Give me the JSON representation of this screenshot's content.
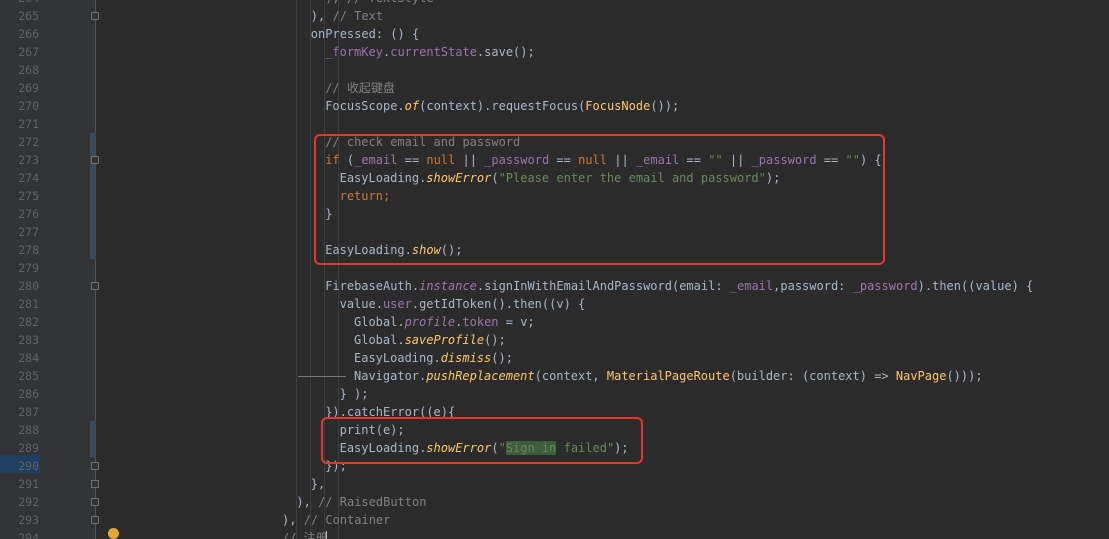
{
  "editor": {
    "language": "dart",
    "colors": {
      "background": "#2b2b2b",
      "gutter": "#313335",
      "keyword": "#cc7832",
      "property": "#9876aa",
      "string": "#6a8759",
      "comment": "#808080",
      "function": "#ffc66d",
      "highlight_box": "#e4372e"
    },
    "lines": [
      {
        "num": "264",
        "indent": 26,
        "tokens": [
          {
            "t": "), // TextStyle",
            "c": "c"
          }
        ]
      },
      {
        "num": "265",
        "indent": 24,
        "tokens": [
          {
            "t": "), ",
            "c": "n"
          },
          {
            "t": "// Text",
            "c": "c"
          }
        ]
      },
      {
        "num": "266",
        "indent": 24,
        "tokens": [
          {
            "t": "onPressed",
            "c": "n"
          },
          {
            "t": ": () {",
            "c": "n"
          }
        ]
      },
      {
        "num": "267",
        "indent": 26,
        "tokens": [
          {
            "t": "_formKey",
            "c": "p"
          },
          {
            "t": ".",
            "c": "n"
          },
          {
            "t": "currentState",
            "c": "p"
          },
          {
            "t": ".save();",
            "c": "n"
          }
        ]
      },
      {
        "num": "268",
        "indent": 0,
        "tokens": []
      },
      {
        "num": "269",
        "indent": 26,
        "tokens": [
          {
            "t": "// 收起键盘",
            "c": "c"
          }
        ]
      },
      {
        "num": "270",
        "indent": 26,
        "tokens": [
          {
            "t": "FocusScope.",
            "c": "n"
          },
          {
            "t": "of",
            "c": "fi"
          },
          {
            "t": "(context).requestFocus(",
            "c": "n"
          },
          {
            "t": "FocusNode",
            "c": "f"
          },
          {
            "t": "());",
            "c": "n"
          }
        ]
      },
      {
        "num": "271",
        "indent": 0,
        "tokens": []
      },
      {
        "num": "272",
        "indent": 26,
        "tokens": [
          {
            "t": "// check email and password",
            "c": "c"
          }
        ]
      },
      {
        "num": "273",
        "indent": 26,
        "tokens": [
          {
            "t": "if",
            "c": "k"
          },
          {
            "t": " (",
            "c": "n"
          },
          {
            "t": "_email",
            "c": "p"
          },
          {
            "t": " == ",
            "c": "n"
          },
          {
            "t": "null",
            "c": "k"
          },
          {
            "t": " || ",
            "c": "n"
          },
          {
            "t": "_password",
            "c": "p"
          },
          {
            "t": " == ",
            "c": "n"
          },
          {
            "t": "null",
            "c": "k"
          },
          {
            "t": " || ",
            "c": "n"
          },
          {
            "t": "_email",
            "c": "p"
          },
          {
            "t": " == ",
            "c": "n"
          },
          {
            "t": "\"\"",
            "c": "s"
          },
          {
            "t": " || ",
            "c": "n"
          },
          {
            "t": "_password",
            "c": "p"
          },
          {
            "t": " == ",
            "c": "n"
          },
          {
            "t": "\"\"",
            "c": "s"
          },
          {
            "t": ") {",
            "c": "n"
          }
        ]
      },
      {
        "num": "274",
        "indent": 28,
        "tokens": [
          {
            "t": "EasyLoading.",
            "c": "n"
          },
          {
            "t": "showError",
            "c": "fi"
          },
          {
            "t": "(",
            "c": "n"
          },
          {
            "t": "\"Please enter the email and password\"",
            "c": "s"
          },
          {
            "t": ");",
            "c": "n"
          }
        ]
      },
      {
        "num": "275",
        "indent": 28,
        "tokens": [
          {
            "t": "return",
            "c": "k"
          },
          {
            "t": ";",
            "c": "k"
          }
        ]
      },
      {
        "num": "276",
        "indent": 26,
        "tokens": [
          {
            "t": "}",
            "c": "n"
          }
        ]
      },
      {
        "num": "277",
        "indent": 0,
        "tokens": []
      },
      {
        "num": "278",
        "indent": 26,
        "tokens": [
          {
            "t": "EasyLoading.",
            "c": "n"
          },
          {
            "t": "show",
            "c": "fi"
          },
          {
            "t": "();",
            "c": "n"
          }
        ]
      },
      {
        "num": "279",
        "indent": 0,
        "tokens": []
      },
      {
        "num": "280",
        "indent": 26,
        "tokens": [
          {
            "t": "FirebaseAuth.",
            "c": "n"
          },
          {
            "t": "instance",
            "c": "pi"
          },
          {
            "t": ".signInWithEmailAndPassword(email: ",
            "c": "n"
          },
          {
            "t": "_email",
            "c": "p"
          },
          {
            "t": ",password: ",
            "c": "n"
          },
          {
            "t": "_password",
            "c": "p"
          },
          {
            "t": ").then((value) {",
            "c": "n"
          }
        ]
      },
      {
        "num": "281",
        "indent": 28,
        "tokens": [
          {
            "t": "value.",
            "c": "n"
          },
          {
            "t": "user",
            "c": "p"
          },
          {
            "t": ".getIdToken().then((v) {",
            "c": "n"
          }
        ]
      },
      {
        "num": "282",
        "indent": 30,
        "tokens": [
          {
            "t": "Global.",
            "c": "n"
          },
          {
            "t": "profile",
            "c": "pi"
          },
          {
            "t": ".",
            "c": "n"
          },
          {
            "t": "token",
            "c": "p"
          },
          {
            "t": " = v;",
            "c": "n"
          }
        ]
      },
      {
        "num": "283",
        "indent": 30,
        "tokens": [
          {
            "t": "Global.",
            "c": "n"
          },
          {
            "t": "saveProfile",
            "c": "fi"
          },
          {
            "t": "();",
            "c": "n"
          }
        ]
      },
      {
        "num": "284",
        "indent": 30,
        "tokens": [
          {
            "t": "EasyLoading.",
            "c": "n"
          },
          {
            "t": "dismiss",
            "c": "fi"
          },
          {
            "t": "();",
            "c": "n"
          }
        ]
      },
      {
        "num": "285",
        "indent": 30,
        "tokens": [
          {
            "t": "Navigator.",
            "c": "n"
          },
          {
            "t": "pushReplacement",
            "c": "fi"
          },
          {
            "t": "(context, ",
            "c": "n"
          },
          {
            "t": "MaterialPageRoute",
            "c": "f"
          },
          {
            "t": "(builder: (context) => ",
            "c": "n"
          },
          {
            "t": "NavPage",
            "c": "f"
          },
          {
            "t": "()));",
            "c": "n"
          }
        ]
      },
      {
        "num": "286",
        "indent": 28,
        "tokens": [
          {
            "t": "} );",
            "c": "n"
          }
        ]
      },
      {
        "num": "287",
        "indent": 26,
        "tokens": [
          {
            "t": "}).catchError((e){",
            "c": "n"
          }
        ]
      },
      {
        "num": "288",
        "indent": 28,
        "tokens": [
          {
            "t": "print(e);",
            "c": "n"
          }
        ]
      },
      {
        "num": "289",
        "indent": 28,
        "tokens": [
          {
            "t": "EasyLoading.",
            "c": "n"
          },
          {
            "t": "showError",
            "c": "fi"
          },
          {
            "t": "(",
            "c": "n"
          },
          {
            "t": "\"",
            "c": "s"
          },
          {
            "t": "Sign in",
            "c": "s",
            "sel": true
          },
          {
            "t": " failed\"",
            "c": "s"
          },
          {
            "t": ");",
            "c": "n"
          }
        ]
      },
      {
        "num": "290",
        "indent": 26,
        "tokens": [
          {
            "t": "});",
            "c": "n"
          }
        ]
      },
      {
        "num": "291",
        "indent": 24,
        "tokens": [
          {
            "t": "},",
            "c": "n"
          }
        ]
      },
      {
        "num": "292",
        "indent": 22,
        "tokens": [
          {
            "t": "), ",
            "c": "n"
          },
          {
            "t": "// RaisedButton",
            "c": "c"
          }
        ]
      },
      {
        "num": "293",
        "indent": 20,
        "tokens": [
          {
            "t": "), ",
            "c": "n"
          },
          {
            "t": "// Container",
            "c": "c"
          }
        ]
      },
      {
        "num": "294",
        "indent": 20,
        "tokens": [
          {
            "t": "// 注册",
            "c": "c"
          }
        ]
      }
    ]
  }
}
